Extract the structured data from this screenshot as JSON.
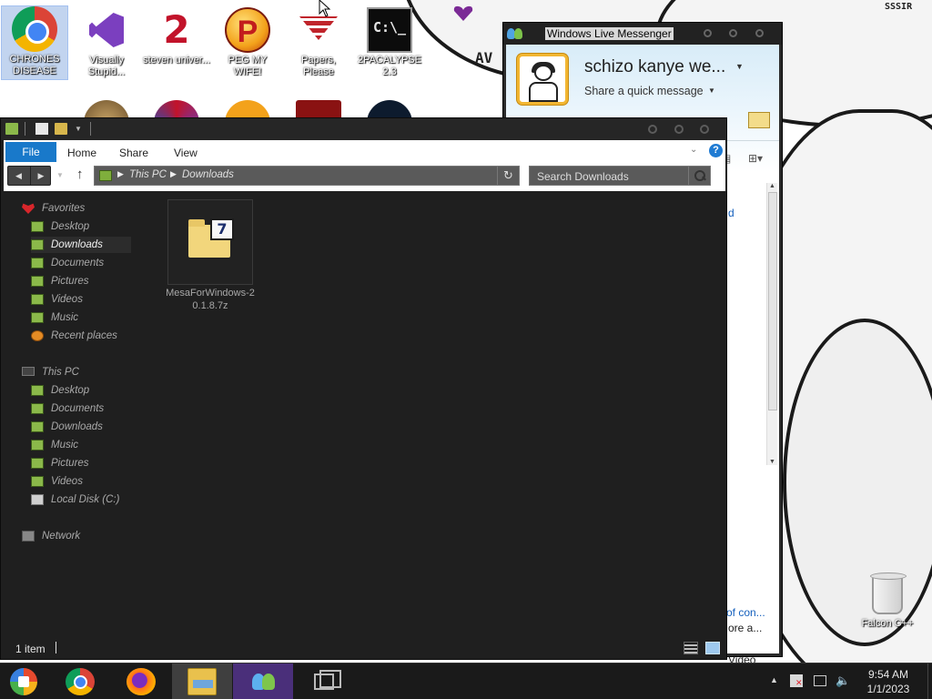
{
  "desktop": {
    "wallpaper_text": "SSSIR",
    "wallpaper_letters": "AV",
    "icons": [
      {
        "label": "CHRONES DISEASE",
        "icon": "chrome-icon",
        "selected": true
      },
      {
        "label": "Visually Stupid...",
        "icon": "visual-studio-icon"
      },
      {
        "label": "steven univer...",
        "icon": "steven-universe-icon"
      },
      {
        "label": "PEG MY WIFE!",
        "icon": "peggle-icon"
      },
      {
        "label": "Papers, Please",
        "icon": "papers-please-icon"
      },
      {
        "label": "2PACALYPSE 2.3",
        "icon": "command-prompt-icon"
      }
    ],
    "recycle_bin_label": "Falcon C++"
  },
  "messenger": {
    "title": "Windows Live Messenger",
    "display_name": "schizo kanye we...",
    "personal_message": "Share a quick message",
    "partial_texts": {
      "link_d": "d",
      "link_con": "of con...",
      "more": "ore a...",
      "video": "Video"
    }
  },
  "explorer": {
    "ribbon": {
      "file_tab": "File",
      "tabs": [
        "Home",
        "Share",
        "View"
      ],
      "help_glyph": "?"
    },
    "address": {
      "breadcrumbs": [
        "This PC",
        "Downloads"
      ],
      "search_placeholder": "Search Downloads"
    },
    "nav_pane": {
      "favorites_label": "Favorites",
      "favorites": [
        "Desktop",
        "Downloads",
        "Documents",
        "Pictures",
        "Videos",
        "Music",
        "Recent places"
      ],
      "selected": "Downloads",
      "this_pc_label": "This PC",
      "this_pc": [
        "Desktop",
        "Documents",
        "Downloads",
        "Music",
        "Pictures",
        "Videos",
        "Local Disk (C:)"
      ],
      "network_label": "Network"
    },
    "files": [
      {
        "name": "MesaForWindows-20.1.8.7z",
        "badge": "7",
        "type": "7z-archive"
      }
    ],
    "status": {
      "item_count": "1 item"
    }
  },
  "taskbar": {
    "pinned": [
      "start",
      "chrome",
      "firefox",
      "file-explorer",
      "windows-live-messenger",
      "task-view"
    ],
    "clock": {
      "time": "9:54 AM",
      "date": "1/1/2023"
    }
  }
}
